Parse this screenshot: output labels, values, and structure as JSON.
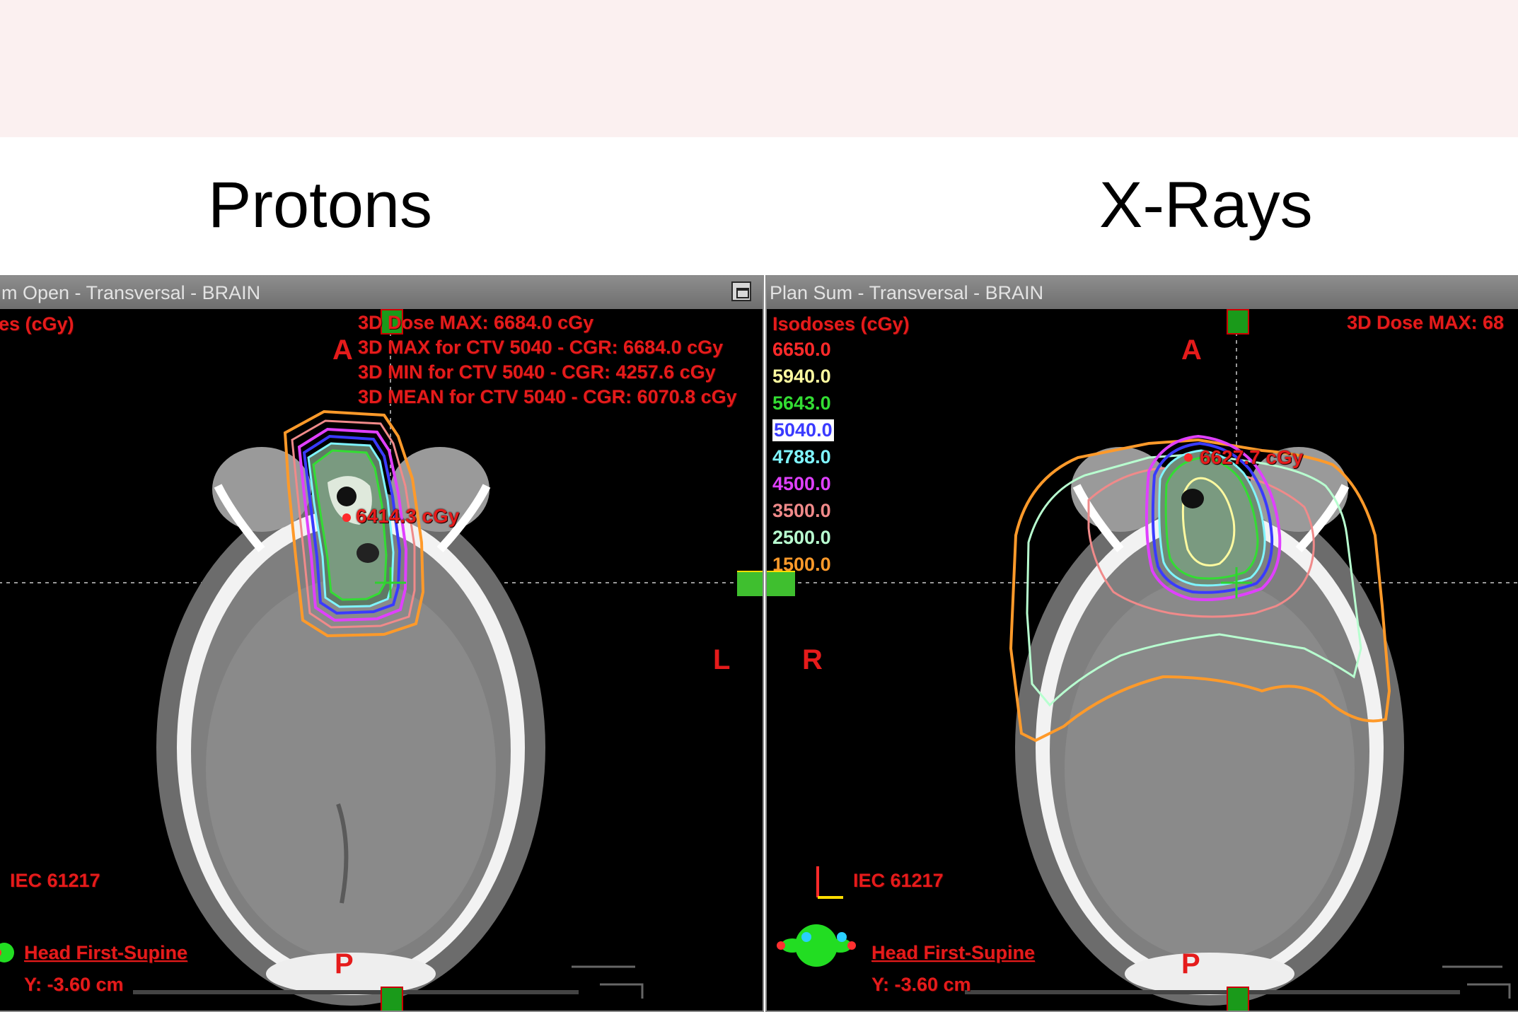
{
  "headings": {
    "left": "Protons",
    "right": "X-Rays"
  },
  "left_panel": {
    "title": "m Open - Transversal - BRAIN",
    "isodose_header": "es (cGy)",
    "stats": [
      "3D Dose MAX: 6684.0 cGy",
      "3D MAX for CTV 5040 - CGR: 6684.0 cGy",
      "3D MIN for CTV 5040 - CGR: 4257.6 cGy",
      "3D MEAN for CTV 5040 - CGR: 6070.8 cGy"
    ],
    "point_dose": "6414.3 cGy",
    "orient": {
      "anterior": "A",
      "posterior": "P",
      "left": "L"
    },
    "coord_system": "IEC 61217",
    "patient_position": "Head First-Supine",
    "slice_position": "Y: -3.60 cm"
  },
  "right_panel": {
    "title": "Plan Sum - Transversal - BRAIN",
    "isodose_header": "Isodoses (cGy)",
    "isodoses": [
      {
        "value": "6650.0",
        "color": "#ff2a2a"
      },
      {
        "value": "5940.0",
        "color": "#fffaa0"
      },
      {
        "value": "5643.0",
        "color": "#33dd33"
      },
      {
        "value": "5040.0",
        "color": "#3a3aff"
      },
      {
        "value": "4788.0",
        "color": "#7ff5ff"
      },
      {
        "value": "4500.0",
        "color": "#e040ff"
      },
      {
        "value": "3500.0",
        "color": "#f08a8a"
      },
      {
        "value": "2500.0",
        "color": "#b8ffd0"
      },
      {
        "value": "1500.0",
        "color": "#ff9a2a"
      }
    ],
    "stats": [
      "3D Dose MAX: 68"
    ],
    "point_dose": "6627.7 cGy",
    "orient": {
      "anterior": "A",
      "posterior": "P",
      "right": "R"
    },
    "coord_system": "IEC 61217",
    "patient_position": "Head First-Supine",
    "slice_position": "Y: -3.60 cm"
  },
  "colors": {
    "overlay_text": "#e51b1b",
    "panel_bg": "#000000",
    "titlebar": "#7a7a7a"
  }
}
